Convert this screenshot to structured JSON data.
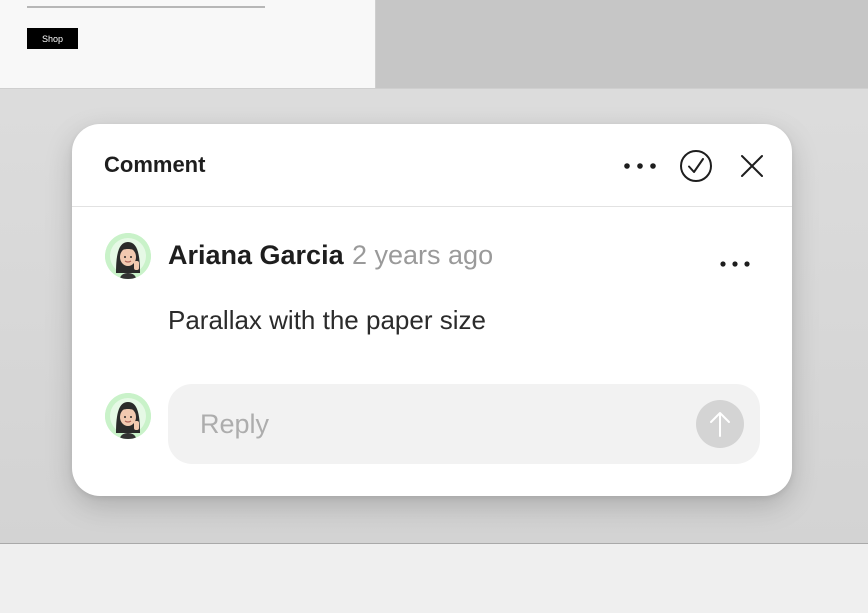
{
  "background_frame": {
    "shop_label": "Shop"
  },
  "comment_panel": {
    "title": "Comment",
    "icons": {
      "more": "more-horizontal-icon",
      "resolve": "check-circle-icon",
      "close": "close-icon",
      "send": "arrow-up-icon"
    },
    "comment": {
      "author": "Ariana Garcia",
      "timestamp": "2 years ago",
      "text": "Parallax with the paper size"
    },
    "reply": {
      "placeholder": "Reply"
    }
  },
  "colors": {
    "avatar_ring": "#c9f2c9",
    "send_button": "#d4d4d4",
    "reply_bg": "#f2f2f2",
    "timestamp": "#9a9a9a"
  }
}
